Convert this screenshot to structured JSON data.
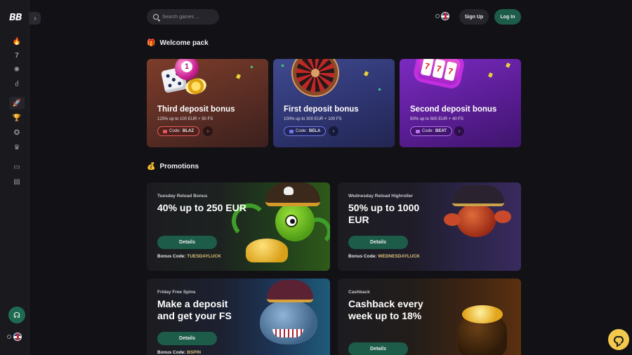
{
  "brand": {
    "logo_text": "BB"
  },
  "sidebar": {
    "collapse_glyph": "›",
    "items": [
      {
        "name": "fire-icon",
        "glyph": "🔥"
      },
      {
        "name": "seven-icon",
        "glyph": "7"
      },
      {
        "name": "roulette-icon",
        "glyph": "✺"
      },
      {
        "name": "cherries-icon",
        "glyph": "ძ"
      },
      {
        "name": "rocket-icon",
        "glyph": "🚀"
      },
      {
        "name": "trophy-icon",
        "glyph": "🏆"
      },
      {
        "name": "award-icon",
        "glyph": "✪"
      },
      {
        "name": "crown-icon",
        "glyph": "♛"
      },
      {
        "name": "wallet-icon",
        "glyph": "▭"
      },
      {
        "name": "document-icon",
        "glyph": "▤"
      }
    ]
  },
  "header": {
    "search_placeholder": "Search games ...",
    "signup_label": "Sign Up",
    "login_label": "Log In"
  },
  "welcome": {
    "title": "Welcome pack",
    "cards": [
      {
        "title": "Third deposit bonus",
        "subtitle": "125% up to 100 EUR + 50 FS",
        "code_label": "Code:",
        "code": "BLAZ"
      },
      {
        "title": "First deposit bonus",
        "subtitle": "100% up to 300 EUR + 100 FS",
        "code_label": "Code:",
        "code": "BELA"
      },
      {
        "title": "Second deposit bonus",
        "subtitle": "50% up to 500 EUR + 40 FS",
        "code_label": "Code:",
        "code": "BEAT"
      }
    ]
  },
  "promotions": {
    "title": "Promotions",
    "cards": [
      {
        "category": "Tuesday Reload Bonus",
        "title": "40% up to 250 EUR",
        "details_label": "Details",
        "code_label": "Bonus Code:",
        "code": "TUESDAYLUCK"
      },
      {
        "category": "Wednesday Reload Highroller",
        "title": "50% up to 1000 EUR",
        "details_label": "Details",
        "code_label": "Bonus Code:",
        "code": "WEDNESDAYLUCK"
      },
      {
        "category": "Friday Free Spins",
        "title": "Make a deposit and get your FS",
        "details_label": "Details",
        "code_label": "Bonus Code:",
        "code": "BSPIN"
      },
      {
        "category": "Cashback",
        "title": "Cashback every week up to 18%",
        "details_label": "Details",
        "code_label": "",
        "code": ""
      }
    ]
  },
  "colors": {
    "accent_green": "#1d5c49",
    "background": "#121115",
    "chat_yellow": "#f2c94c"
  }
}
